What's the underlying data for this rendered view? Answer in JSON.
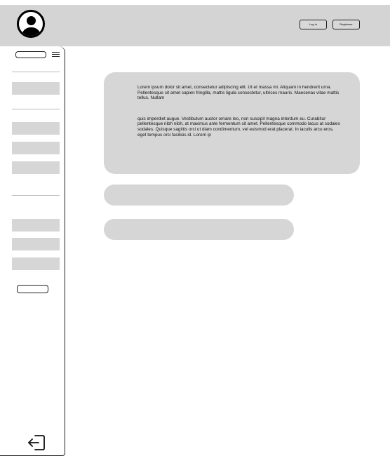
{
  "header": {
    "login_label": "Log In",
    "register_label": "Registreer"
  },
  "main": {
    "card": {
      "paragraph1": "Lorem ipsum dolor sit amet, consectetur adipiscing elit. Ut et massa mi. Aliquam in hendrerit urna. Pellentesque sit amet sapien fringilla, mattis ligula consectetur, ultrices mauris. Maecenas vitae mattis tellus. Nullam",
      "paragraph2": "quis imperdiet augue. Vestibulum auctor ornare leo, non suscipit magna interdum eu. Curabitur pellentesque nibh nibh, at maximus ante fermentum sit amet. Pellentesque commodo lacus at sodales sodales. Quisque sagittis orci ut diam condimentum, vel euismod erat placerat. In iaculis arcu eros, eget tempus orci facilisis id. Lorem ip"
    }
  },
  "icons": {
    "avatar": "user-avatar-icon",
    "menu": "hamburger-menu-icon",
    "logout": "logout-icon"
  }
}
